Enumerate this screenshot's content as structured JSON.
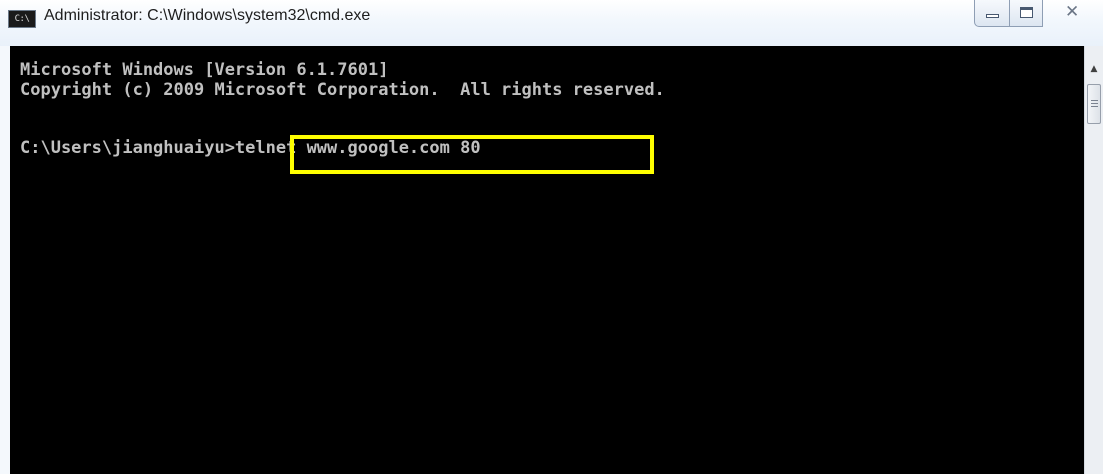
{
  "window": {
    "title": "Administrator: C:\\Windows\\system32\\cmd.exe",
    "app_icon_text": "C:\\",
    "close_glyph": "✕"
  },
  "console": {
    "lines": [
      "Microsoft Windows [Version 6.1.7601]",
      "Copyright (c) 2009 Microsoft Corporation.  All rights reserved.",
      "C:\\Users\\jianghuaiyu>telnet www.google.com 80"
    ],
    "text_color": "#c0c0c0",
    "background_color": "#000000"
  },
  "annotation": {
    "highlight_color": "#ffff00"
  },
  "scrollbar": {
    "up_arrow": "▲"
  },
  "icons": [
    "cmd-app-icon",
    "minimize-icon",
    "maximize-icon",
    "close-icon",
    "scroll-up-arrow-icon",
    "scroll-thumb-grip-icon"
  ]
}
